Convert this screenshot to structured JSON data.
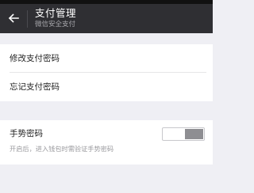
{
  "header": {
    "back_icon": "arrow-left-icon",
    "title": "支付管理",
    "subtitle": "微信安全支付"
  },
  "password_settings": {
    "items": [
      {
        "label": "修改支付密码"
      },
      {
        "label": "忘记支付密码"
      }
    ]
  },
  "gesture_password": {
    "label": "手势密码",
    "description": "开启后，进入钱包时需验证手势密码",
    "enabled": false
  },
  "colors": {
    "appbar": "#2f2f33",
    "background": "#efeff4",
    "toggle_off": "#8e8e92"
  }
}
